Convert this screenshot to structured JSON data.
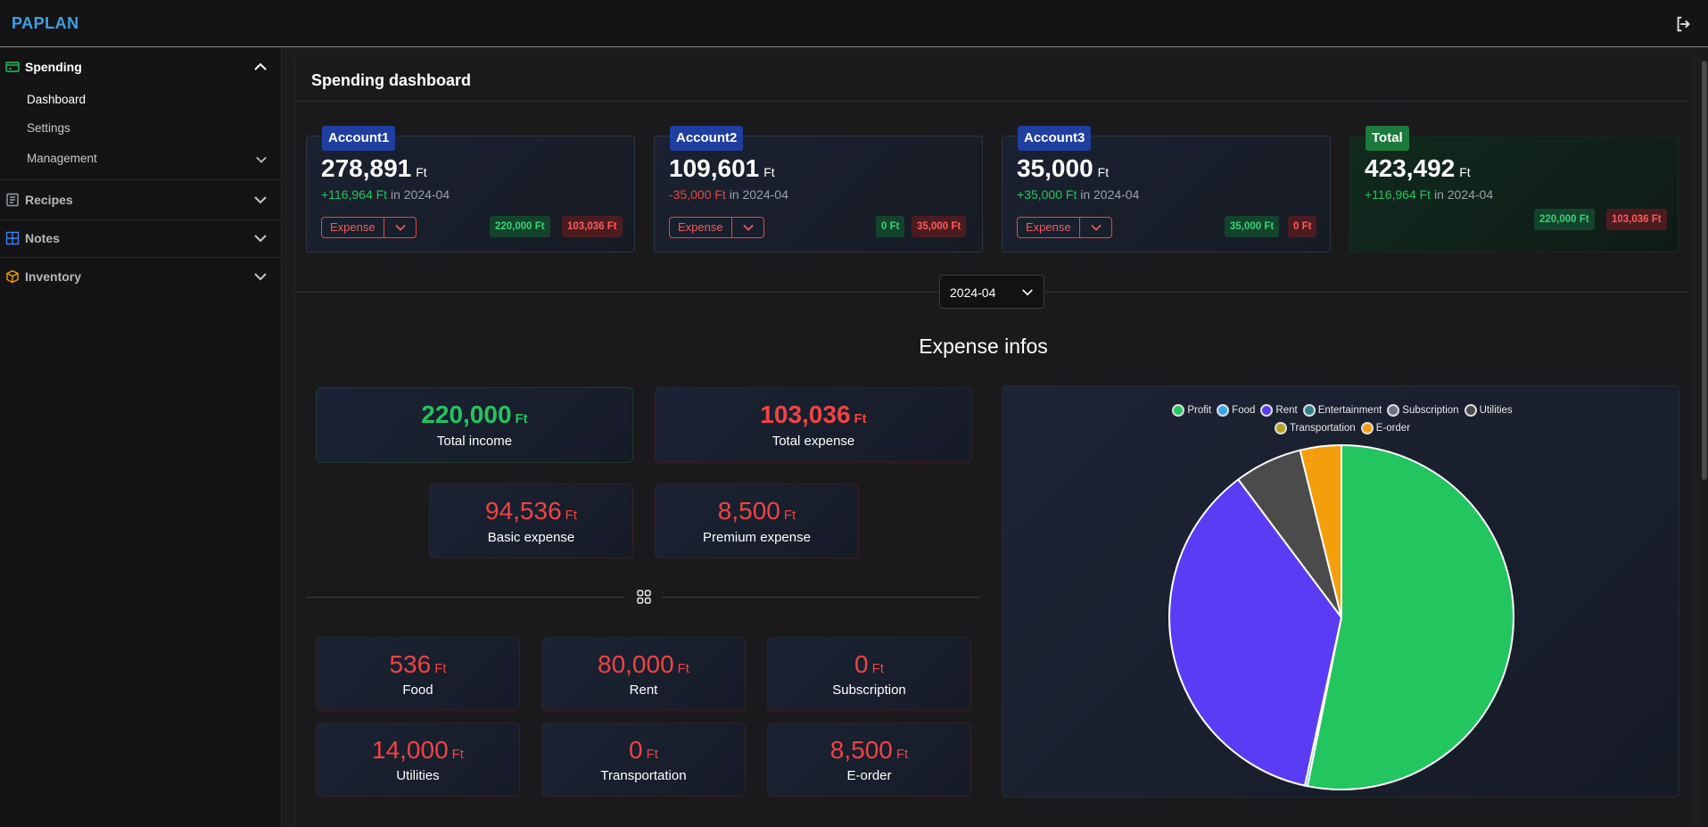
{
  "app": {
    "brand": "PAPLAN"
  },
  "sidebar": {
    "sections": [
      {
        "label": "Spending",
        "icon": "credit-card-icon",
        "color": "#22c55e"
      },
      {
        "label": "Recipes",
        "icon": "book-icon",
        "color": "#9aa0a8"
      },
      {
        "label": "Notes",
        "icon": "grid-icon",
        "color": "#3b82f6"
      },
      {
        "label": "Inventory",
        "icon": "box-icon",
        "color": "#f59e0b"
      }
    ],
    "spending_items": [
      "Dashboard",
      "Settings",
      "Management"
    ]
  },
  "page": {
    "title": "Spending dashboard"
  },
  "accounts": [
    {
      "name": "Account1",
      "amount": "278,891",
      "unit": "Ft",
      "change": "+116,964 Ft",
      "period": "in 2024-04",
      "button": "Expense",
      "income": "220,000 Ft",
      "expense": "103,036 Ft"
    },
    {
      "name": "Account2",
      "amount": "109,601",
      "unit": "Ft",
      "change": "-35,000 Ft",
      "period": "in 2024-04",
      "button": "Expense",
      "income": "0 Ft",
      "expense": "35,000 Ft"
    },
    {
      "name": "Account3",
      "amount": "35,000",
      "unit": "Ft",
      "change": "+35,000 Ft",
      "period": "in 2024-04",
      "button": "Expense",
      "income": "35,000 Ft",
      "expense": "0 Ft"
    },
    {
      "name": "Total",
      "amount": "423,492",
      "unit": "Ft",
      "change": "+116,964 Ft",
      "period": "in 2024-04",
      "income": "220,000 Ft",
      "expense": "103,036 Ft"
    }
  ],
  "month_select": {
    "value": "2024-04"
  },
  "expense": {
    "title": "Expense infos",
    "summary": [
      {
        "value": "220,000",
        "unit": "Ft",
        "label": "Total income"
      },
      {
        "value": "103,036",
        "unit": "Ft",
        "label": "Total expense"
      },
      {
        "value": "94,536",
        "unit": "Ft",
        "label": "Basic expense"
      },
      {
        "value": "8,500",
        "unit": "Ft",
        "label": "Premium expense"
      }
    ],
    "categories": [
      {
        "value": "536",
        "unit": "Ft",
        "label": "Food"
      },
      {
        "value": "80,000",
        "unit": "Ft",
        "label": "Rent"
      },
      {
        "value": "0",
        "unit": "Ft",
        "label": "Subscription"
      },
      {
        "value": "14,000",
        "unit": "Ft",
        "label": "Utilities"
      },
      {
        "value": "0",
        "unit": "Ft",
        "label": "Transportation"
      },
      {
        "value": "8,500",
        "unit": "Ft",
        "label": "E-order"
      }
    ]
  },
  "chart_data": {
    "type": "pie",
    "categories": [
      "Profit",
      "Food",
      "Rent",
      "Entertainment",
      "Subscription",
      "Utilities",
      "Transportation",
      "E-order"
    ],
    "values": [
      116964,
      536,
      80000,
      0,
      0,
      14000,
      0,
      8500
    ],
    "colors": [
      "#22c55e",
      "#38a5f0",
      "#5b3cf5",
      "#2a7f8a",
      "#6b7280",
      "#4b4b4b",
      "#b8a020",
      "#f59e0b"
    ],
    "legend": "top"
  }
}
